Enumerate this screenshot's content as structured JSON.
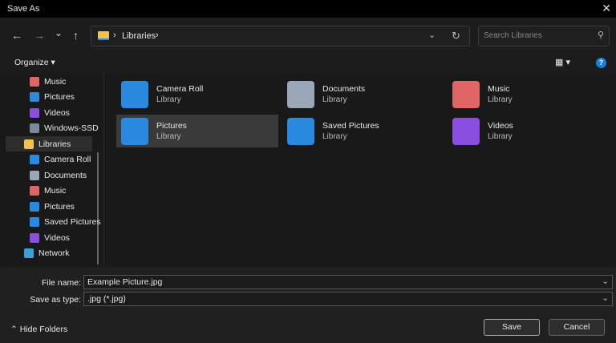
{
  "window": {
    "title": "Save As",
    "close": "✕"
  },
  "toolbar": {
    "back": "←",
    "forward": "→",
    "recent": "⌄",
    "up": "↑",
    "breadcrumb": [
      "Libraries"
    ],
    "search_placeholder": "Search Libraries"
  },
  "cmdbar": {
    "organize": "Organize ▾",
    "view": "▦ ▾",
    "help": "?"
  },
  "nav": [
    {
      "label": "Music",
      "icon": "music-icon",
      "color": "#e06666"
    },
    {
      "label": "Pictures",
      "icon": "pictures-icon",
      "color": "#2a8ae0"
    },
    {
      "label": "Videos",
      "icon": "videos-icon",
      "color": "#8a4fe0"
    },
    {
      "label": "Windows-SSD",
      "icon": "drive-icon",
      "color": "#7a8a9a"
    },
    {
      "label": "Libraries",
      "icon": "folder-icon",
      "color": "#f2c14e"
    },
    {
      "label": "Camera Roll",
      "icon": "pictures-icon",
      "color": "#2a8ae0"
    },
    {
      "label": "Documents",
      "icon": "documents-icon",
      "color": "#9aa7b8"
    },
    {
      "label": "Music",
      "icon": "music-icon",
      "color": "#e06666"
    },
    {
      "label": "Pictures",
      "icon": "pictures-icon",
      "color": "#2a8ae0"
    },
    {
      "label": "Saved Pictures",
      "icon": "pictures-icon",
      "color": "#2a8ae0"
    },
    {
      "label": "Videos",
      "icon": "videos-icon",
      "color": "#8a4fe0"
    },
    {
      "label": "Network",
      "icon": "network-icon",
      "color": "#3aa0d8"
    }
  ],
  "libraries": [
    {
      "name": "Camera Roll",
      "type": "Library",
      "color": "#2a8ae0"
    },
    {
      "name": "Documents",
      "type": "Library",
      "color": "#9aa7b8"
    },
    {
      "name": "Music",
      "type": "Library",
      "color": "#e06666"
    },
    {
      "name": "Pictures",
      "type": "Library",
      "color": "#2a8ae0"
    },
    {
      "name": "Saved Pictures",
      "type": "Library",
      "color": "#2a8ae0"
    },
    {
      "name": "Videos",
      "type": "Library",
      "color": "#8a4fe0"
    }
  ],
  "form": {
    "file_name_label": "File name:",
    "file_name": "Example Picture.jpg",
    "type_label": "Save as type:",
    "type": ".jpg (*.jpg)"
  },
  "footer": {
    "hide_folders": "Hide Folders",
    "save": "Save",
    "cancel": "Cancel"
  }
}
